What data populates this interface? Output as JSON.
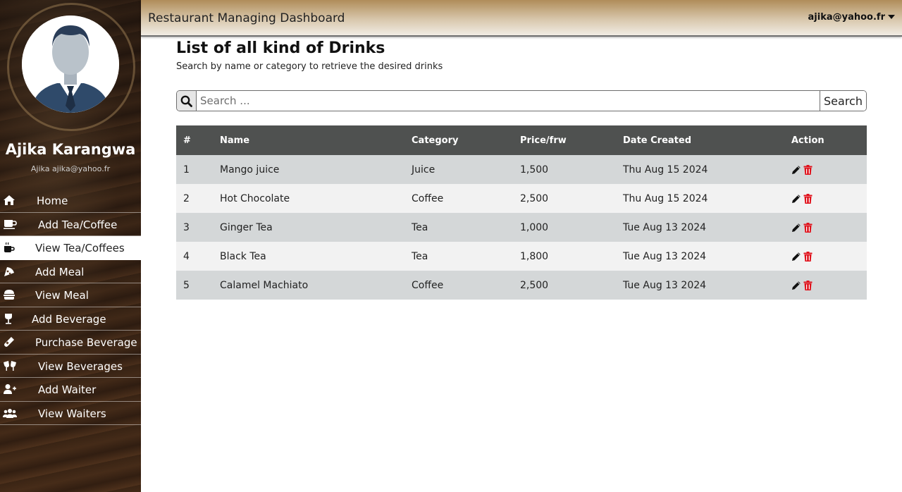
{
  "header": {
    "title": "Restaurant Managing Dashboard",
    "user_email": "ajika@yahoo.fr"
  },
  "profile": {
    "name": "Ajika Karangwa",
    "subtitle": "Ajika ajika@yahoo.fr"
  },
  "sidebar": {
    "items": [
      {
        "label": "Home",
        "icon": "home-icon"
      },
      {
        "label": "Add Tea/Coffee",
        "icon": "cup-icon"
      },
      {
        "label": "View Tea/Coffees",
        "icon": "mug-hot-icon",
        "active": true
      },
      {
        "label": "Add Meal",
        "icon": "pizza-slice-icon"
      },
      {
        "label": "View Meal",
        "icon": "burger-icon"
      },
      {
        "label": "Add Beverage",
        "icon": "wine-glass-icon"
      },
      {
        "label": "Purchase Beverage",
        "icon": "bottle-icon"
      },
      {
        "label": "View Beverages",
        "icon": "glass-cheers-icon"
      },
      {
        "label": "Add Waiter",
        "icon": "user-plus-icon"
      },
      {
        "label": "View Waiters",
        "icon": "users-icon"
      }
    ]
  },
  "main": {
    "title": "List of all kind of Drinks",
    "subtitle": "Search by name or category to retrieve the desired drinks",
    "search": {
      "placeholder": "Search ...",
      "button_label": "Search"
    },
    "table": {
      "columns": [
        "#",
        "Name",
        "Category",
        "Price/frw",
        "Date Created",
        "Action"
      ],
      "rows": [
        {
          "num": "1",
          "name": "Mango juice",
          "category": "Juice",
          "price": "1,500",
          "date": "Thu Aug 15 2024"
        },
        {
          "num": "2",
          "name": "Hot Chocolate",
          "category": "Coffee",
          "price": "2,500",
          "date": "Thu Aug 15 2024"
        },
        {
          "num": "3",
          "name": "Ginger Tea",
          "category": "Tea",
          "price": "1,000",
          "date": "Tue Aug 13 2024"
        },
        {
          "num": "4",
          "name": "Black Tea",
          "category": "Tea",
          "price": "1,800",
          "date": "Tue Aug 13 2024"
        },
        {
          "num": "5",
          "name": "Calamel Machiato",
          "category": "Coffee",
          "price": "2,500",
          "date": "Tue Aug 13 2024"
        }
      ]
    }
  },
  "colors": {
    "header_top": "#b08d5a",
    "table_header": "#4f5150",
    "row_odd": "#d4d7d8",
    "row_even": "#f2f2f2",
    "delete_red": "#e0101a"
  }
}
